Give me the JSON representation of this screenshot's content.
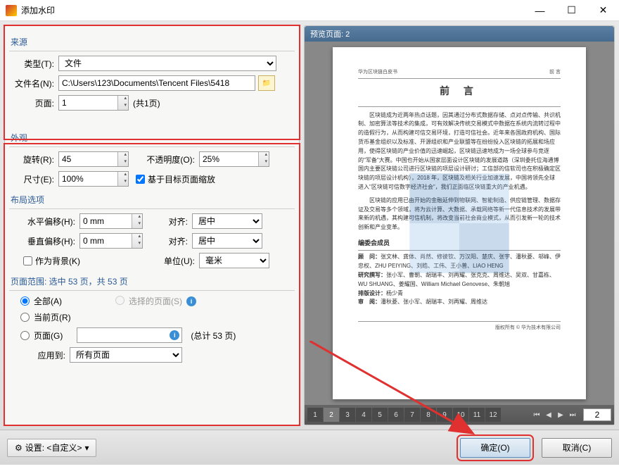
{
  "window": {
    "title": "添加水印"
  },
  "source": {
    "header": "来源",
    "type_label": "类型(T):",
    "type_value": "文件",
    "filename_label": "文件名(N):",
    "filename_value": "C:\\Users\\123\\Documents\\Tencent Files\\5418",
    "page_label": "页面:",
    "page_value": "1",
    "page_total": "(共1页)"
  },
  "appearance": {
    "header": "外观",
    "rotate_label": "旋转(R):",
    "rotate_value": "45",
    "opacity_label": "不透明度(O):",
    "opacity_value": "25%",
    "scale_label": "尺寸(E):",
    "scale_value": "100%",
    "target_scale_label": "基于目标页面缩放"
  },
  "layout": {
    "header": "布局选项",
    "hoffset_label": "水平偏移(H):",
    "hoffset_value": "0 mm",
    "voffset_label": "垂直偏移(H):",
    "voffset_value": "0 mm",
    "align_label": "对齐:",
    "halign_value": "居中",
    "valign_value": "居中",
    "background_label": "作为背景(K)",
    "unit_label": "单位(U):",
    "unit_value": "毫米"
  },
  "pagerange": {
    "header": "页面范围: 选中 53 页，共 53 页",
    "all_label": "全部(A)",
    "selected_label": "选择的页面(S)",
    "current_label": "当前页(R)",
    "page_label": "页面(G)",
    "page_total": "(总计 53 页)",
    "applyto_label": "应用到:",
    "applyto_value": "所有页面"
  },
  "preview": {
    "header": "预览页面: 2",
    "thumbs": [
      "1",
      "2",
      "3",
      "4",
      "5",
      "6",
      "7",
      "8",
      "9",
      "10",
      "11",
      "12"
    ],
    "selected_thumb": 1,
    "page_input": "2",
    "doc": {
      "header_left": "华为区块链白皮书",
      "header_right": "前 言",
      "title": "前 言",
      "para1": "区块链成为近两年热点话题，因其通过分布式数据存储、点对点传输、共识机制、加密算法等技术的集成，可有效解决传统交易模式中数据在系统内流转过程中的造假行为，从而构建可信交易环境，打造可信社会。近年来各国政府机构、国际货币基金组织以及标准、开源组织和产业联盟等在纷纷投入区块链的拓展和场应用，使得区块链的产业价值的迅速崛起，区块链迅速地成为一场全球参与竞逐的\"军备\"大赛。中国也开始从国家层面设计区块链的发展道路（深圳委托位海通博国内主要区块链公司进行区块链的项层设计研讨；工信部的信软司也在积极确定区块链的项层设计机构），2018 年，区块链及相关行业加速发展，中国将领先全球进入\"区块链可信数字经济社会\"，我们正面临区块链重大的产业机遇。",
      "para2": "区块链的应用已由开始的金融延伸到物联网、智能制造、供应链管理、数据存证及交易等多个领域，将为云计算、大数据、承载网络等新一代信息技术的发展带来新的机遇，其构建可信机制，将改变当前社会商业模式，从而引发新一轮的技术创新和产业变革。",
      "board_header": "编委会成员",
      "advisors_label": "顾　问：",
      "advisors": "张文林、龚体、肖然、修彼钦、万汉阳、楚庆、张宇、潘秋菱、邬峰、伊忠权、ZHU PEIYING、刘皓、工伟、王小普、LIAO HENG",
      "research_label": "研究撰写：",
      "research": "张小军、曹朝、胡瑞丰、刘再耀、张克克、周维达、吴双、甘嘉栋、WU SHUANG、姜耀国、William Michael Genovese、朱朝旭",
      "layout_label": "排版设计：",
      "layout_name": "杨少青",
      "review_label": "审　阅：",
      "review": "潘秋菱、张小军、胡瑞丰、刘再耀、周维达",
      "copyright": "版权所有 © 华为技术有限公司"
    }
  },
  "footer": {
    "settings": "设置: <自定义>",
    "ok": "确定(O)",
    "cancel": "取消(C)"
  }
}
